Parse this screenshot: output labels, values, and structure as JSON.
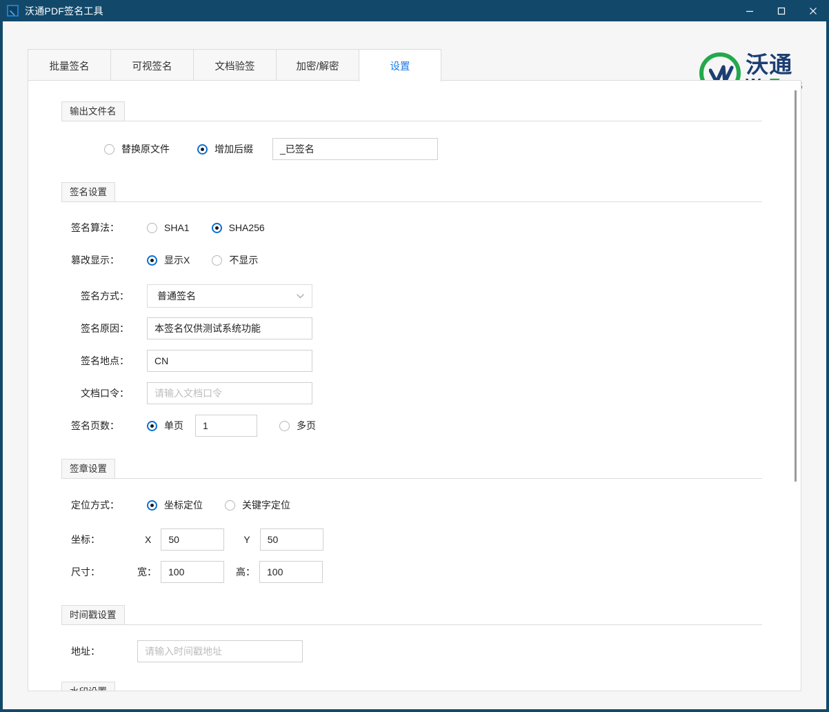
{
  "window": {
    "title": "沃通PDF签名工具",
    "icon": "pen-square-icon",
    "controls": {
      "minimize": "minimize-icon",
      "maximize": "maximize-icon",
      "close": "close-icon"
    },
    "frame_color": "#12496b"
  },
  "logo": {
    "cn": "沃通",
    "en_first": "Wo",
    "en_second": "Trus",
    "green": "#23a94b",
    "blue": "#1c3f73"
  },
  "tabs": [
    {
      "label": "批量签名",
      "active": false
    },
    {
      "label": "可视签名",
      "active": false
    },
    {
      "label": "文档验签",
      "active": false
    },
    {
      "label": "加密/解密",
      "active": false
    },
    {
      "label": "设置",
      "active": true
    }
  ],
  "active_tab_color": "#1a7ae6",
  "sections": {
    "output_filename": {
      "title": "输出文件名",
      "replace_original": "替换原文件",
      "replace_original_selected": false,
      "add_suffix": "增加后缀",
      "add_suffix_selected": true,
      "suffix_value": "_已签名"
    },
    "signature_settings": {
      "title": "签名设置",
      "algorithm_label": "签名算法：",
      "algorithm_sha1": "SHA1",
      "algorithm_sha1_selected": false,
      "algorithm_sha256": "SHA256",
      "algorithm_sha256_selected": true,
      "tamper_label": "篡改显示：",
      "tamper_show": "显示X",
      "tamper_show_selected": true,
      "tamper_hide": "不显示",
      "tamper_hide_selected": false,
      "method_label": "签名方式：",
      "method_value": "普通签名",
      "reason_label": "签名原因：",
      "reason_value": "本签名仅供测试系统功能",
      "location_label": "签名地点：",
      "location_value": "CN",
      "password_label": "文档口令：",
      "password_placeholder": "请输入文档口令",
      "pages_label": "签名页数：",
      "pages_single": "单页",
      "pages_single_selected": true,
      "pages_single_value": "1",
      "pages_multi": "多页",
      "pages_multi_selected": false
    },
    "stamp_settings": {
      "title": "签章设置",
      "position_label": "定位方式：",
      "position_coord": "坐标定位",
      "position_coord_selected": true,
      "position_keyword": "关键字定位",
      "position_keyword_selected": false,
      "coord_label": "坐标：",
      "coord_x_label": "X",
      "coord_x_value": "50",
      "coord_y_label": "Y",
      "coord_y_value": "50",
      "size_label": "尺寸：",
      "size_w_label": "宽：",
      "size_w_value": "100",
      "size_h_label": "高：",
      "size_h_value": "100"
    },
    "timestamp_settings": {
      "title": "时间戳设置",
      "address_label": "地址：",
      "address_placeholder": "请输入时间戳地址"
    },
    "watermark_settings": {
      "title": "水印设置"
    }
  }
}
